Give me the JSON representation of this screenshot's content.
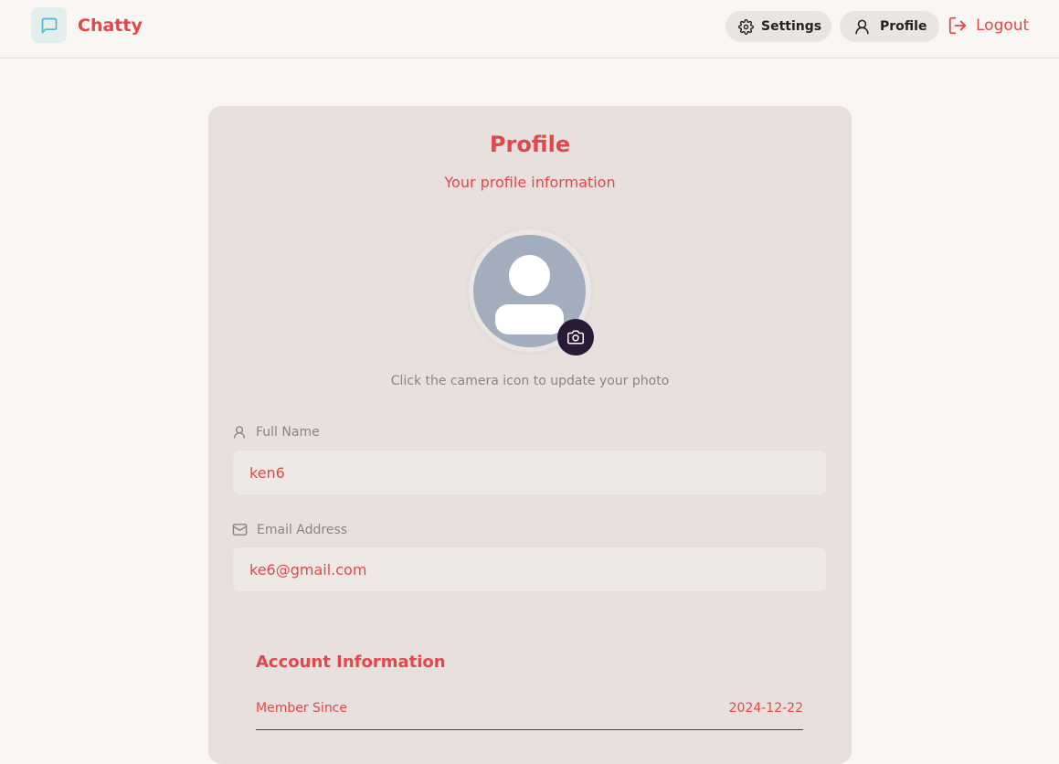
{
  "header": {
    "brand_name": "Chatty",
    "settings_label": "Settings",
    "profile_label": "Profile",
    "logout_label": "Logout"
  },
  "profile": {
    "title": "Profile",
    "subtitle": "Your profile information",
    "avatar_hint": "Click the camera icon to update your photo",
    "full_name_label": "Full Name",
    "full_name_value": "ken6",
    "email_label": "Email Address",
    "email_value": "ke6@gmail.com"
  },
  "account": {
    "title": "Account Information",
    "rows": [
      {
        "label": "Member Since",
        "value": "2024-12-22"
      }
    ]
  },
  "icons": {
    "brand": "message-square-icon",
    "settings": "gear-icon",
    "profile": "user-icon",
    "logout": "logout-icon",
    "camera": "camera-icon",
    "full_name": "user-icon",
    "email": "mail-icon"
  },
  "colors": {
    "accent": "#e2484b",
    "background": "#faf6f3",
    "card": "#e8e0dd",
    "camera_button": "#2a1a35",
    "brand_icon": "#4fb8c9"
  }
}
